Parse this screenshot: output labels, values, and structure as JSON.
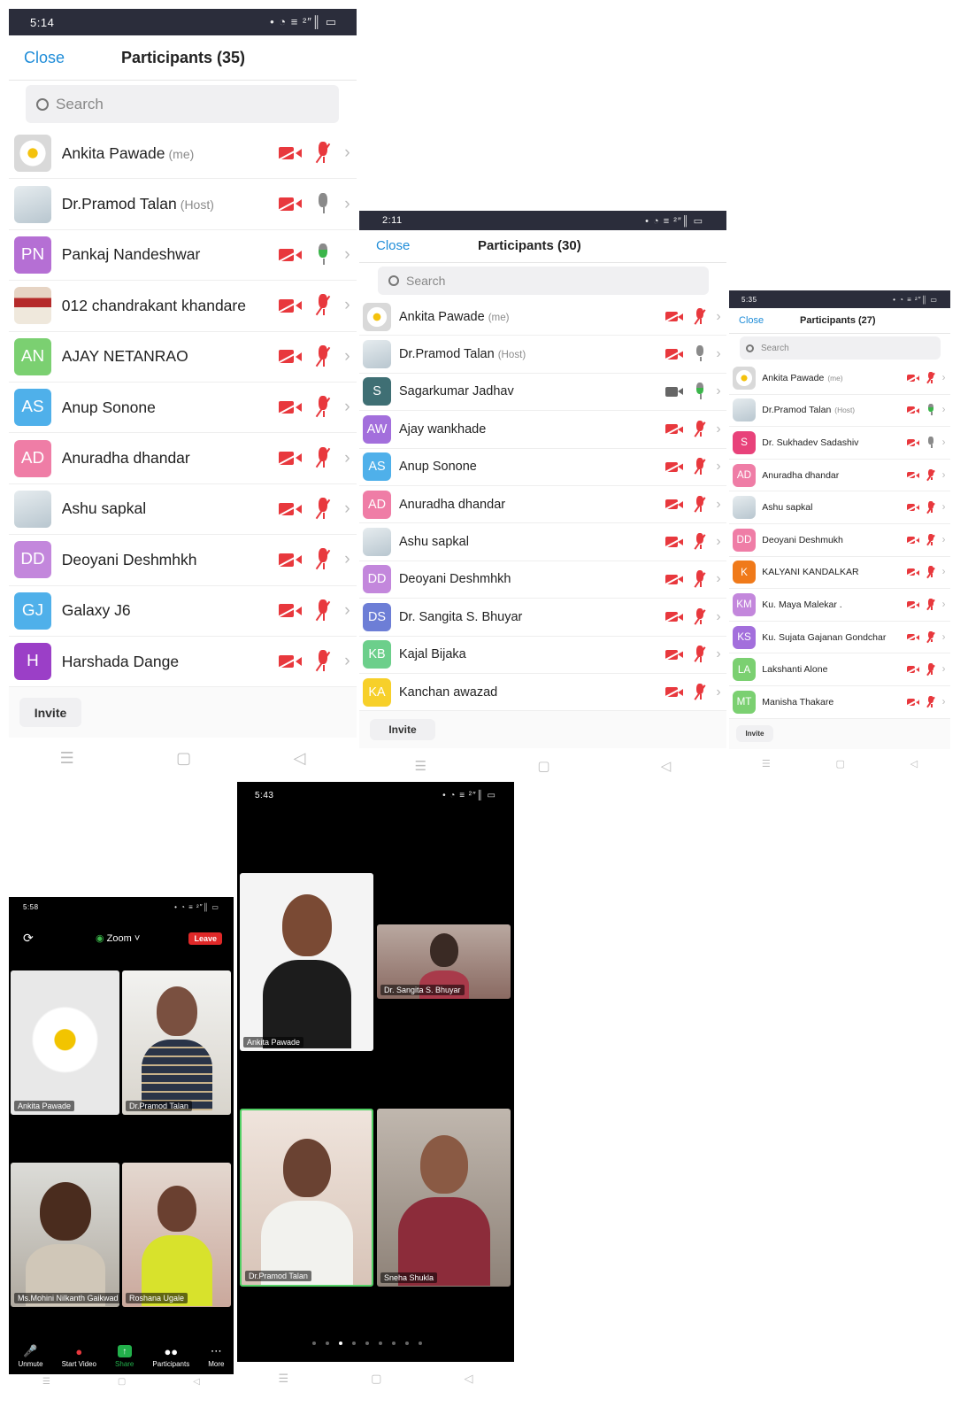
{
  "screen1": {
    "status_time": "5:14",
    "status_right": "• ◔ ≡ ²″║ ▭",
    "close": "Close",
    "title": "Participants (35)",
    "search_placeholder": "Search",
    "participants": [
      {
        "initials": "",
        "name": "Ankita Pawade",
        "tag": "(me)",
        "avatar": "flower",
        "color": "",
        "camera": "off",
        "mic": "muted"
      },
      {
        "initials": "",
        "name": "Dr.Pramod Talan",
        "tag": "(Host)",
        "avatar": "photo",
        "color": "",
        "camera": "off",
        "mic": "off"
      },
      {
        "initials": "PN",
        "name": "Pankaj Nandeshwar",
        "tag": "",
        "avatar": "initials",
        "color": "#b56fd4",
        "camera": "off",
        "mic": "talking"
      },
      {
        "initials": "",
        "name": "012 chandrakant khandare",
        "tag": "",
        "avatar": "newspaper",
        "color": "",
        "camera": "off",
        "mic": "muted"
      },
      {
        "initials": "AN",
        "name": "AJAY NETANRAO",
        "tag": "",
        "avatar": "initials",
        "color": "#7bd071",
        "camera": "off",
        "mic": "muted"
      },
      {
        "initials": "AS",
        "name": "Anup Sonone",
        "tag": "",
        "avatar": "initials",
        "color": "#4fb0ea",
        "camera": "off",
        "mic": "muted"
      },
      {
        "initials": "AD",
        "name": "Anuradha dhandar",
        "tag": "",
        "avatar": "initials",
        "color": "#ef7da6",
        "camera": "off",
        "mic": "muted"
      },
      {
        "initials": "",
        "name": "Ashu sapkal",
        "tag": "",
        "avatar": "photo",
        "color": "",
        "camera": "off",
        "mic": "muted"
      },
      {
        "initials": "DD",
        "name": "Deoyani Deshmhkh",
        "tag": "",
        "avatar": "initials",
        "color": "#c387dc",
        "camera": "off",
        "mic": "muted"
      },
      {
        "initials": "GJ",
        "name": "Galaxy J6",
        "tag": "",
        "avatar": "initials",
        "color": "#4fb0ea",
        "camera": "off",
        "mic": "muted"
      },
      {
        "initials": "H",
        "name": "Harshada Dange",
        "tag": "",
        "avatar": "initials",
        "color": "#9b3fc7",
        "camera": "off",
        "mic": "muted"
      }
    ],
    "invite": "Invite"
  },
  "screen2": {
    "status_time": "2:11",
    "status_right": "• ◔ ≡ ²″║ ▭",
    "close": "Close",
    "title": "Participants (30)",
    "search_placeholder": "Search",
    "participants": [
      {
        "initials": "",
        "name": "Ankita Pawade",
        "tag": "(me)",
        "avatar": "flower",
        "color": "",
        "camera": "off",
        "mic": "muted"
      },
      {
        "initials": "",
        "name": "Dr.Pramod Talan",
        "tag": "(Host)",
        "avatar": "photo",
        "color": "",
        "camera": "off",
        "mic": "off"
      },
      {
        "initials": "S",
        "name": "Sagarkumar Jadhav",
        "tag": "",
        "avatar": "initials",
        "color": "#3f6f74",
        "camera": "on",
        "mic": "talking"
      },
      {
        "initials": "AW",
        "name": "Ajay wankhade",
        "tag": "",
        "avatar": "initials",
        "color": "#a36fdc",
        "camera": "off",
        "mic": "muted"
      },
      {
        "initials": "AS",
        "name": "Anup Sonone",
        "tag": "",
        "avatar": "initials",
        "color": "#4fb0ea",
        "camera": "off",
        "mic": "muted"
      },
      {
        "initials": "AD",
        "name": "Anuradha dhandar",
        "tag": "",
        "avatar": "initials",
        "color": "#ef7da6",
        "camera": "off",
        "mic": "muted"
      },
      {
        "initials": "",
        "name": "Ashu sapkal",
        "tag": "",
        "avatar": "photo",
        "color": "",
        "camera": "off",
        "mic": "muted"
      },
      {
        "initials": "DD",
        "name": "Deoyani Deshmhkh",
        "tag": "",
        "avatar": "initials",
        "color": "#c387dc",
        "camera": "off",
        "mic": "muted"
      },
      {
        "initials": "DS",
        "name": "Dr. Sangita S. Bhuyar",
        "tag": "",
        "avatar": "initials",
        "color": "#6d7ed6",
        "camera": "off",
        "mic": "muted"
      },
      {
        "initials": "KB",
        "name": "Kajal Bijaka",
        "tag": "",
        "avatar": "initials",
        "color": "#6ccf8b",
        "camera": "off",
        "mic": "muted"
      },
      {
        "initials": "KA",
        "name": "Kanchan awazad",
        "tag": "",
        "avatar": "initials",
        "color": "#f7d02a",
        "camera": "off",
        "mic": "muted"
      }
    ],
    "invite": "Invite"
  },
  "screen3": {
    "status_time": "5:35",
    "status_right": "• ◔ ≡ ²″║ ▭",
    "close": "Close",
    "title": "Participants (27)",
    "search_placeholder": "Search",
    "participants": [
      {
        "initials": "",
        "name": "Ankita Pawade",
        "tag": "(me)",
        "avatar": "flower",
        "color": "",
        "camera": "off",
        "mic": "muted"
      },
      {
        "initials": "",
        "name": "Dr.Pramod Talan",
        "tag": "(Host)",
        "avatar": "photo",
        "color": "",
        "camera": "off",
        "mic": "talking"
      },
      {
        "initials": "S",
        "name": "Dr. Sukhadev Sadashiv",
        "tag": "",
        "avatar": "initials",
        "color": "#e8427a",
        "camera": "off",
        "mic": "off"
      },
      {
        "initials": "AD",
        "name": "Anuradha dhandar",
        "tag": "",
        "avatar": "initials",
        "color": "#ef7da6",
        "camera": "off",
        "mic": "muted"
      },
      {
        "initials": "",
        "name": "Ashu sapkal",
        "tag": "",
        "avatar": "photo",
        "color": "",
        "camera": "off",
        "mic": "muted"
      },
      {
        "initials": "DD",
        "name": "Deoyani Deshmukh",
        "tag": "",
        "avatar": "initials",
        "color": "#ef7da6",
        "camera": "off",
        "mic": "muted"
      },
      {
        "initials": "K",
        "name": "KALYANI KANDALKAR",
        "tag": "",
        "avatar": "initials",
        "color": "#f07a1a",
        "camera": "off",
        "mic": "muted"
      },
      {
        "initials": "KM",
        "name": "Ku. Maya Malekar .",
        "tag": "",
        "avatar": "initials",
        "color": "#c387dc",
        "camera": "off",
        "mic": "muted"
      },
      {
        "initials": "KS",
        "name": "Ku. Sujata Gajanan Gondchar",
        "tag": "",
        "avatar": "initials",
        "color": "#a36fdc",
        "camera": "off",
        "mic": "muted"
      },
      {
        "initials": "LA",
        "name": "Lakshanti Alone",
        "tag": "",
        "avatar": "initials",
        "color": "#7bd071",
        "camera": "off",
        "mic": "muted"
      },
      {
        "initials": "MT",
        "name": "Manisha Thakare",
        "tag": "",
        "avatar": "initials",
        "color": "#7bd071",
        "camera": "off",
        "mic": "muted"
      }
    ],
    "invite": "Invite"
  },
  "meeting1": {
    "status_time": "5:58",
    "status_right": "• ◔ ≡ ²″║ ▭",
    "zoom_label": "Zoom",
    "leave_label": "Leave",
    "tiles": [
      "Ankita Pawade",
      "Dr.Pramod Talan",
      "Ms.Mohini Nilkanth Gaikwad",
      "Roshana Ugale"
    ],
    "toolbar": [
      "Unmute",
      "Start Video",
      "Share",
      "Participants",
      "More"
    ]
  },
  "meeting2": {
    "status_time": "5:43",
    "status_right": "• ◔ ≡ ²″║ ▭",
    "tiles": [
      "Ankita Pawade",
      "Dr. Sangita S. Bhuyar",
      "Dr.Pramod Talan",
      "Sneha Shukla"
    ]
  },
  "colors": {
    "accent": "#1e8cd8",
    "muted_red": "#e8383d",
    "status_bar": "#2b2d3b",
    "talking_green": "#3bb54a",
    "leave_red": "#e02828",
    "share_green": "#22b04b",
    "active_speaker": "#52d065"
  }
}
